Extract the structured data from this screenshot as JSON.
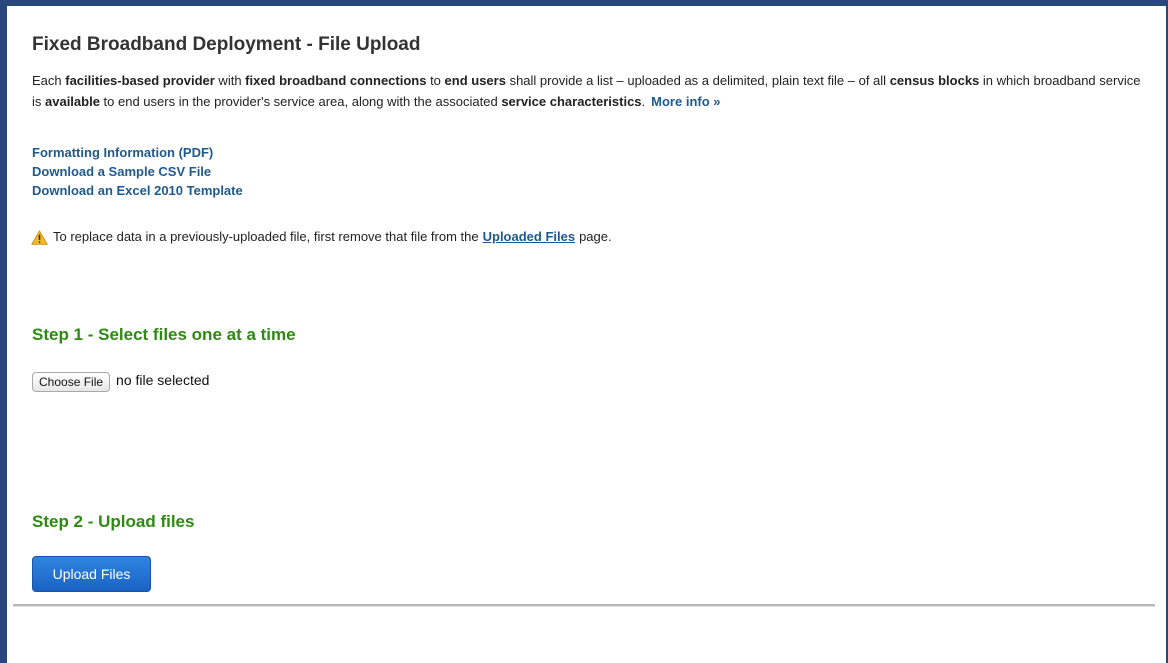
{
  "page": {
    "title": "Fixed Broadband Deployment - File Upload",
    "intro": {
      "t1": "Each ",
      "b1": "facilities-based provider",
      "t2": " with ",
      "b2": "fixed broadband connections",
      "t3": " to ",
      "b3": "end users",
      "t4": " shall provide a list – uploaded as a delimited, plain text file – of all ",
      "b4": "census blocks",
      "t5": " in which broadband service is ",
      "b5": "available",
      "t6": " to end users in the provider's service area, along with the associated ",
      "b6": "service characteristics",
      "t7": ".",
      "more_info": "More info »"
    },
    "links": [
      "Formatting Information (PDF)",
      "Download a Sample CSV File",
      "Download an Excel 2010 Template"
    ],
    "notice": {
      "icon": "warning-icon",
      "before": "To replace data in a previously-uploaded file, first remove that file from the",
      "link": "Uploaded Files",
      "after": "page."
    },
    "step1": {
      "heading": "Step 1 - Select files one at a time",
      "choose_label": "Choose File",
      "file_status": "no file selected"
    },
    "step2": {
      "heading": "Step 2 - Upload files",
      "upload_label": "Upload Files"
    }
  },
  "colors": {
    "frame": "#28487c",
    "link": "#1f5a8f",
    "step_heading": "#2e8b12",
    "upload_button": "#1a62c4"
  }
}
